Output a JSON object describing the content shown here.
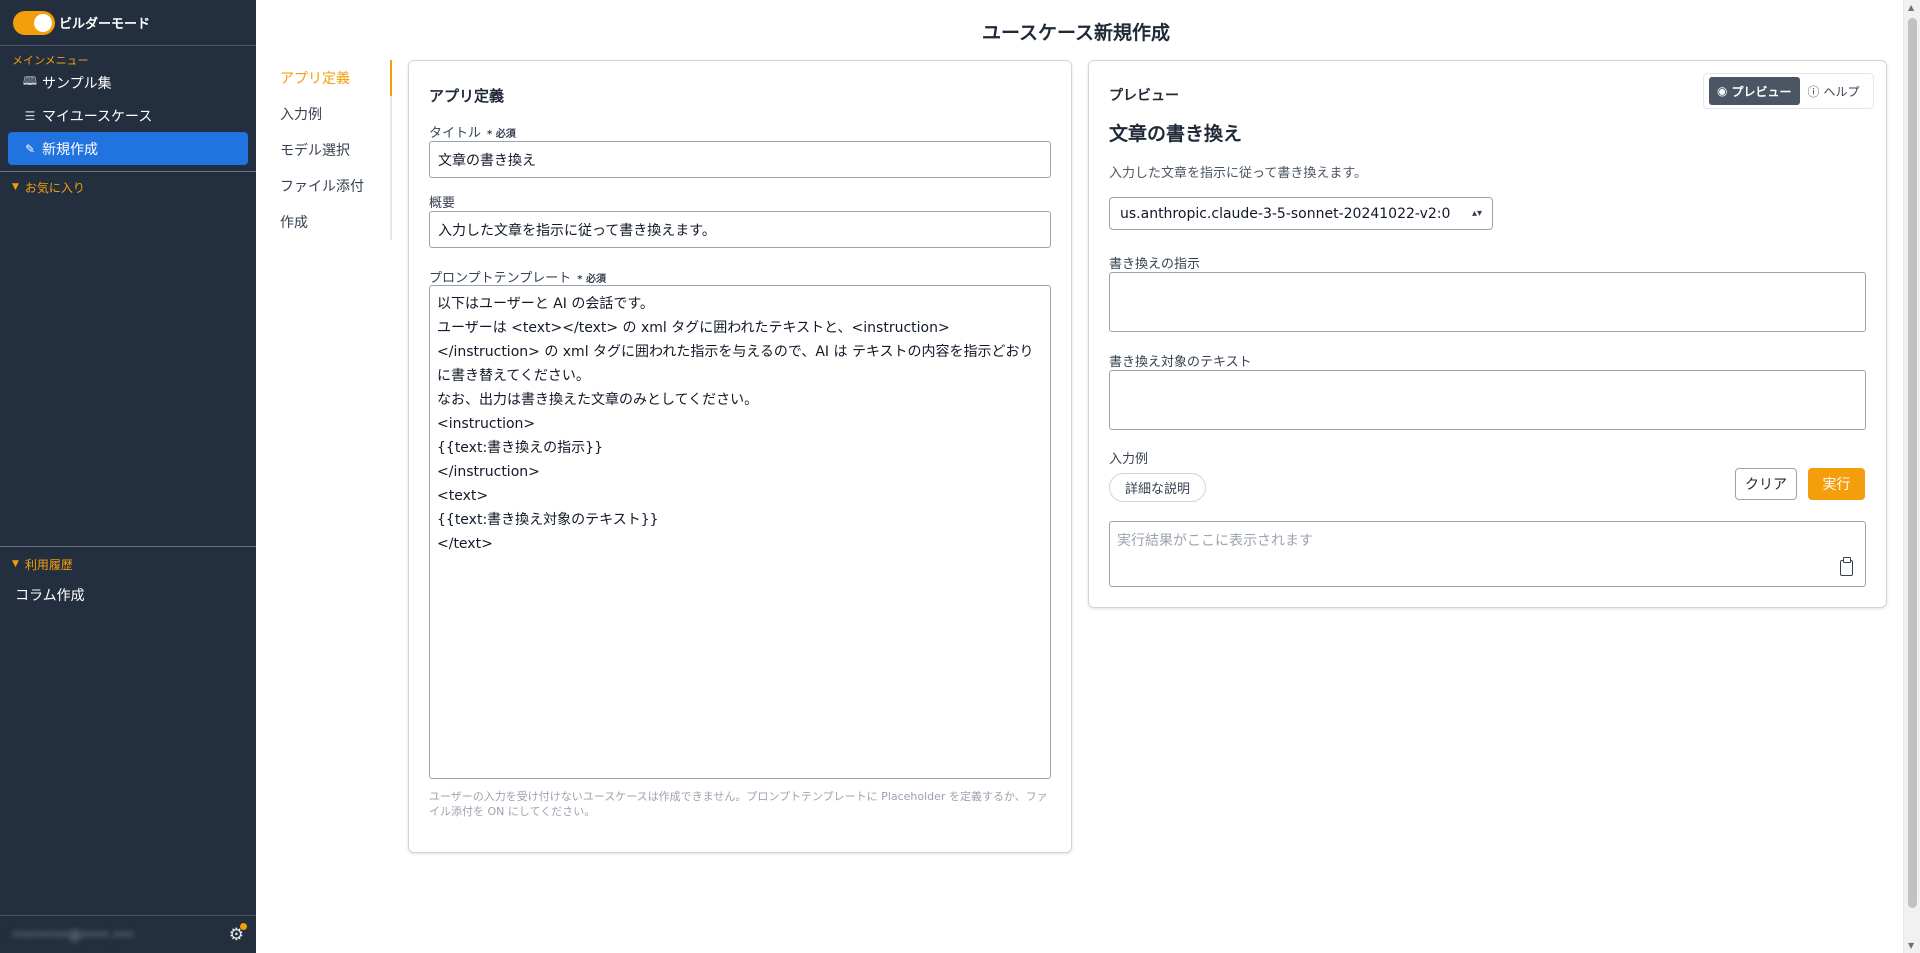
{
  "sidebar": {
    "builder_mode_label": "ビルダーモード",
    "main_menu_label": "メインメニュー",
    "items": [
      {
        "label": "サンプル集",
        "icon": "book-icon"
      },
      {
        "label": "マイユースケース",
        "icon": "list-icon"
      },
      {
        "label": "新規作成",
        "icon": "edit-icon",
        "active": true
      }
    ],
    "favorites_label": "お気に入り",
    "history_label": "利用履歴",
    "history_items": [
      "コラム作成"
    ],
    "user_email": "••••••••@••••.•••",
    "accent_color": "#f59e0b",
    "bg_color": "#232f3e",
    "active_color": "#2173e0"
  },
  "page": {
    "title": "ユースケース新規作成"
  },
  "left_nav": [
    "アプリ定義",
    "入力例",
    "モデル選択",
    "ファイル添付",
    "作成"
  ],
  "app_def": {
    "heading": "アプリ定義",
    "title_label": "タイトル",
    "required_mark": "* 必須",
    "title_value": "文章の書き換え",
    "summary_label": "概要",
    "summary_value": "入力した文章を指示に従って書き換えます。",
    "prompt_label": "プロンプトテンプレート",
    "prompt_value": "以下はユーザーと AI の会話です。\nユーザーは <text></text> の xml タグに囲われたテキストと、<instruction></instruction> の xml タグに囲われた指示を与えるので、AI は テキストの内容を指示どおりに書き替えてください。\nなお、出力は書き換えた文章のみとしてください。\n<instruction>\n{{text:書き換えの指示}}\n</instruction>\n<text>\n{{text:書き換え対象のテキスト}}\n</text>",
    "hint": "ユーザーの入力を受け付けないユースケースは作成できません。プロンプトテンプレートに Placeholder を定義するか、ファイル添付を ON にしてください。"
  },
  "preview": {
    "label": "プレビュー",
    "tab_preview": "プレビュー",
    "tab_help": "ヘルプ",
    "usecase_title": "文章の書き換え",
    "usecase_desc": "入力した文章を指示に従って書き換えます。",
    "model": "us.anthropic.claude-3-5-sonnet-20241022-v2:0",
    "field1_label": "書き換えの指示",
    "field2_label": "書き換え対象のテキスト",
    "examples_label": "入力例",
    "example_chip": "詳細な説明",
    "clear_label": "クリア",
    "run_label": "実行",
    "result_placeholder": "実行結果がここに表示されます"
  }
}
